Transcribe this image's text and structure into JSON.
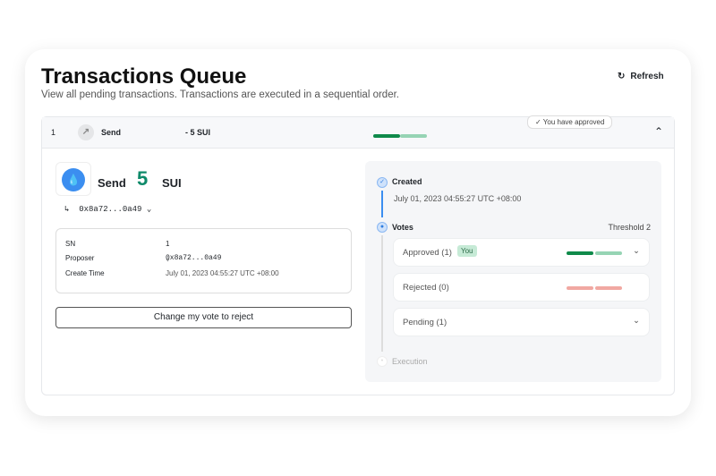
{
  "title": "Transactions Queue",
  "subtitle": "View all pending transactions. Transactions are executed in a sequential order.",
  "refresh": "Refresh",
  "tx": {
    "index": "1",
    "type": "Send",
    "amount": "- 5 SUI",
    "approved_badge": "✓ You have approved",
    "votes_progress": {
      "approved": 1,
      "threshold": 2
    }
  },
  "detail": {
    "send": "Send",
    "amount": "5",
    "token": "SUI",
    "recipient": "0x8a72...0a49",
    "info": [
      {
        "label": "SN",
        "value": "1"
      },
      {
        "label": "Proposer",
        "value": "0x8a72...0a49"
      },
      {
        "label": "Create Time",
        "value": "July 01, 2023 04:55:27 UTC +08:00"
      }
    ],
    "change_vote": "Change my vote to reject"
  },
  "timeline": {
    "created": "Created",
    "created_time": "July 01, 2023 04:55:27 UTC +08:00",
    "votes": "Votes",
    "threshold": "Threshold 2",
    "approved": "Approved (1)",
    "you": "You",
    "rejected": "Rejected (0)",
    "pending": "Pending (1)",
    "execution": "Execution"
  },
  "colors": {
    "green": "#0f8a4a",
    "light_green": "#96d4b4",
    "red": "#f1a8a2",
    "blue": "#3b8ef0"
  }
}
